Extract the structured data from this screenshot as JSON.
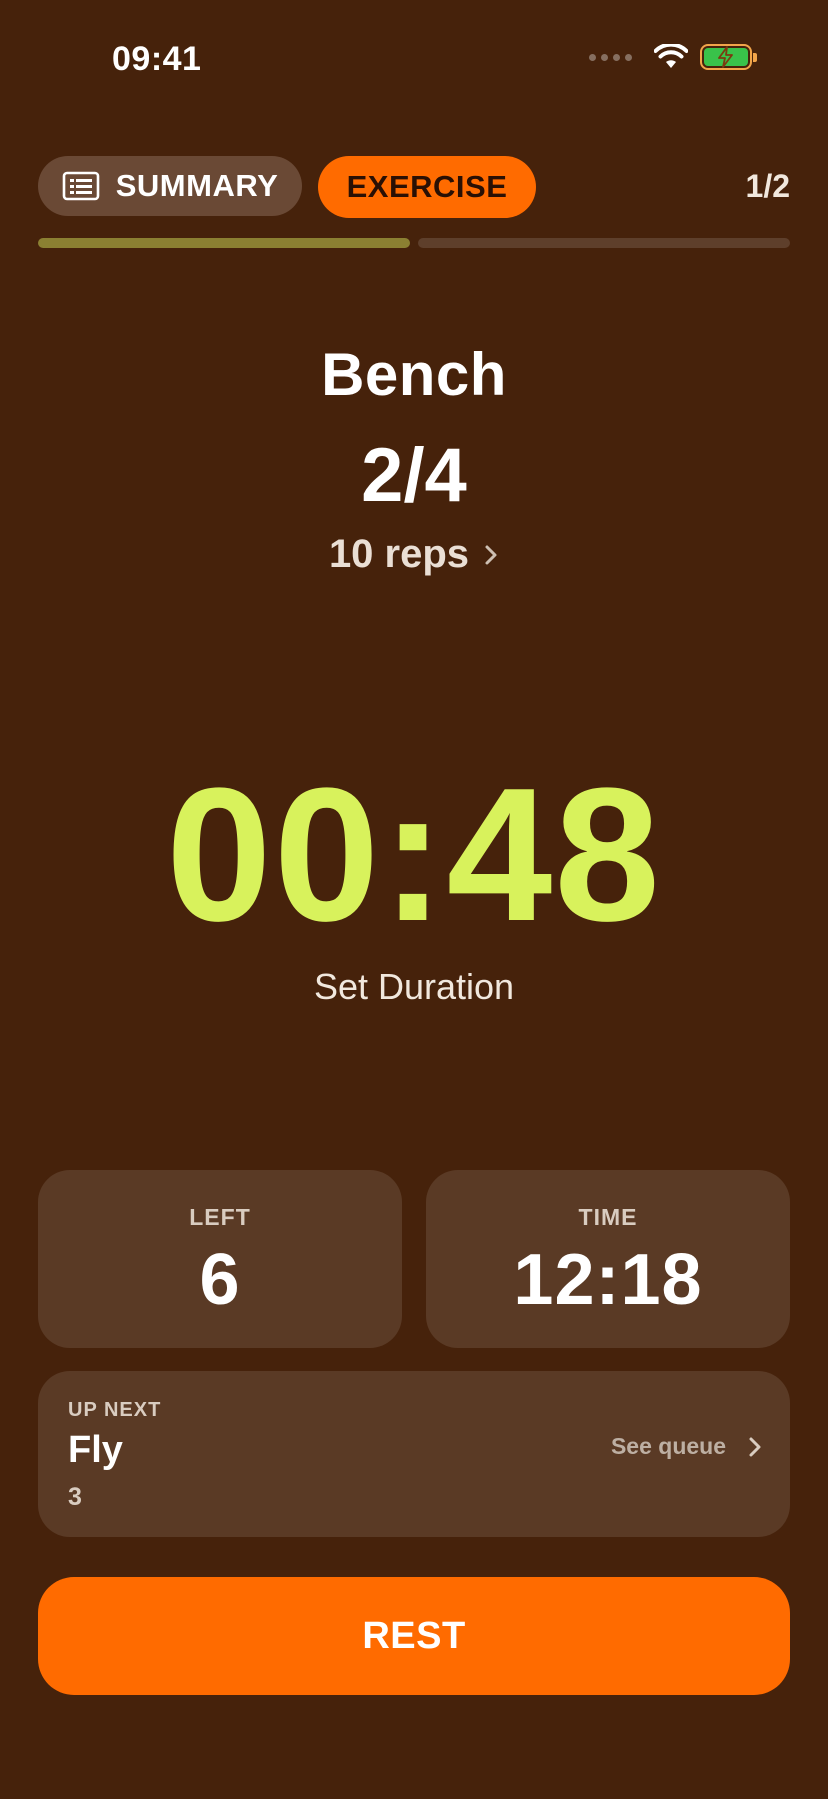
{
  "status_bar": {
    "time": "09:41"
  },
  "tabs": {
    "summary_label": "SUMMARY",
    "summary_icon": "list-icon",
    "exercise_label": "EXERCISE",
    "active_tab": "EXERCISE",
    "page_counter": "1/2"
  },
  "progress": {
    "segments_total": 2,
    "segments_complete": 1,
    "complete_color": "#8B8032",
    "incomplete_color": "#5E3F2B"
  },
  "exercise": {
    "name": "Bench",
    "set_progress": "2/4",
    "reps": "10 reps"
  },
  "timer": {
    "value": "00:48",
    "label": "Set Duration",
    "color": "#D8F25C"
  },
  "stats": {
    "left_label": "LEFT",
    "left_value": "6",
    "time_label": "TIME",
    "time_value": "12:18"
  },
  "up_next": {
    "label": "UP NEXT",
    "name": "Fly",
    "count": "3",
    "link_label": "See queue"
  },
  "actions": {
    "rest_label": "REST"
  },
  "colors": {
    "background": "#46220B",
    "accent": "#FF6B00",
    "card": "#5A3A25"
  }
}
